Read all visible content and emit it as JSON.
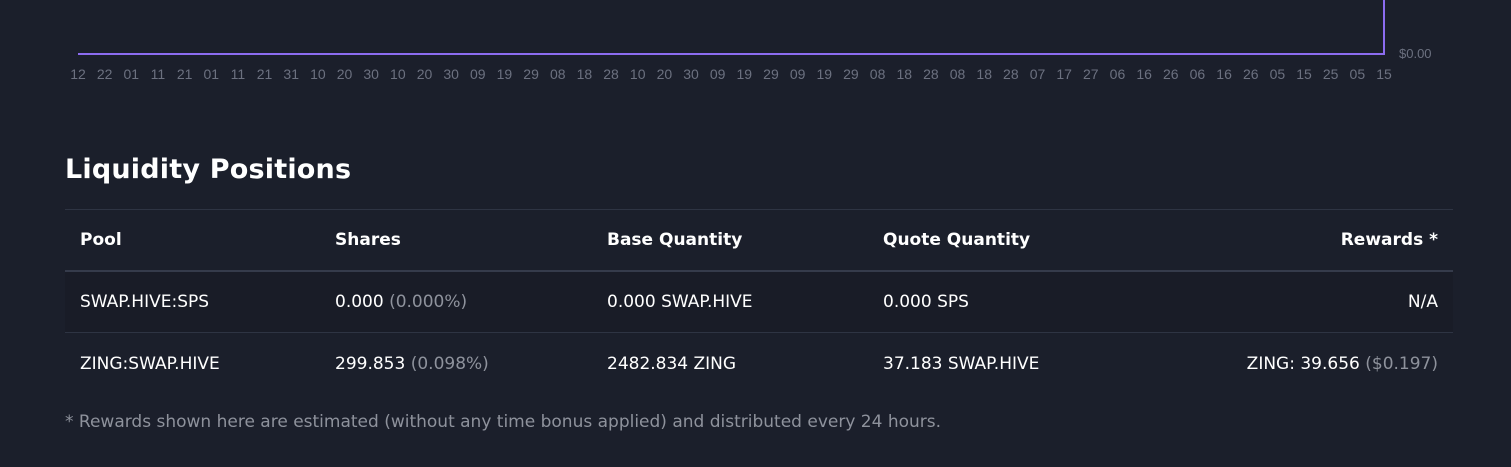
{
  "chart_data": {
    "type": "line",
    "x_tick_labels": [
      "12",
      "22",
      "01",
      "11",
      "21",
      "01",
      "11",
      "21",
      "31",
      "10",
      "20",
      "30",
      "10",
      "20",
      "30",
      "09",
      "19",
      "29",
      "08",
      "18",
      "28",
      "10",
      "20",
      "30",
      "09",
      "19",
      "29",
      "09",
      "19",
      "29",
      "08",
      "18",
      "28",
      "08",
      "18",
      "28",
      "07",
      "17",
      "27",
      "06",
      "16",
      "26",
      "06",
      "16",
      "26",
      "05",
      "15",
      "25",
      "05",
      "15"
    ],
    "y_tick_labels": [
      "$0.00"
    ],
    "line_color": "#8c6cf0",
    "grid": false
  },
  "section": {
    "title": "Liquidity Positions"
  },
  "table": {
    "headers": {
      "pool": "Pool",
      "shares": "Shares",
      "base": "Base Quantity",
      "quote": "Quote Quantity",
      "rewards": "Rewards *"
    },
    "rows": [
      {
        "pool": "SWAP.HIVE:SPS",
        "shares": "0.000",
        "shares_pct": "(0.000%)",
        "base": "0.000 SWAP.HIVE",
        "quote": "0.000 SPS",
        "rewards": "N/A",
        "rewards_usd": ""
      },
      {
        "pool": "ZING:SWAP.HIVE",
        "shares": "299.853",
        "shares_pct": "(0.098%)",
        "base": "2482.834 ZING",
        "quote": "37.183 SWAP.HIVE",
        "rewards": "ZING: 39.656",
        "rewards_usd": "($0.197)"
      }
    ]
  },
  "footnote": "* Rewards shown here are estimated (without any time bonus applied) and distributed every 24 hours.",
  "colors": {
    "background": "#1b1f2b",
    "accent": "#8c6cf0",
    "muted_text": "#8e929c"
  }
}
